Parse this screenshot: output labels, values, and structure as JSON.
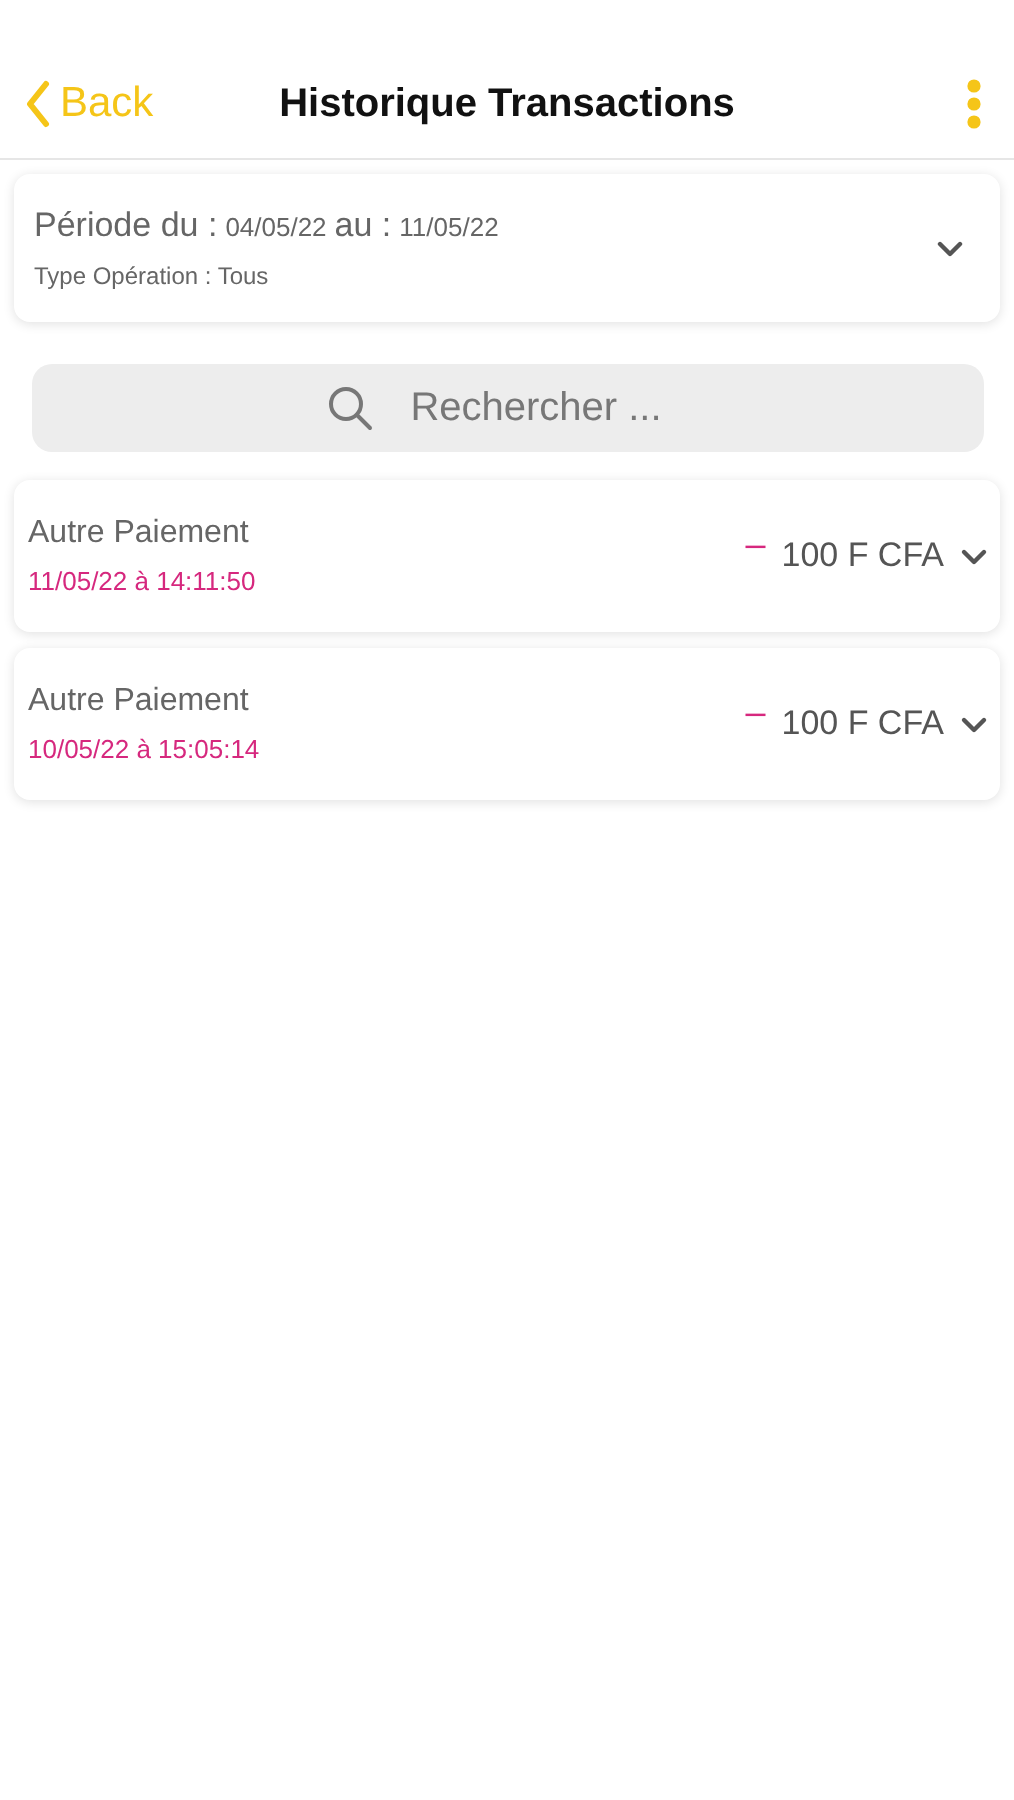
{
  "header": {
    "back": "Back",
    "title": "Historique Transactions"
  },
  "filter": {
    "period": [
      {
        "kind": "label",
        "text": "Période du :"
      },
      {
        "kind": "value",
        "text": "04/05/22"
      },
      {
        "kind": "label",
        "text": "au :"
      },
      {
        "kind": "value",
        "text": "11/05/22"
      }
    ],
    "type": "Type Opération : Tous",
    "expanded": false
  },
  "search": {
    "placeholder": "Rechercher ..."
  },
  "transactions": [
    {
      "label": "Autre Paiement",
      "date": "11/05/22 à 14:11:50",
      "sign": "–",
      "amount": "100 F CFA",
      "expanded": false
    },
    {
      "label": "Autre Paiement",
      "date": "10/05/22 à 15:05:14",
      "sign": "–",
      "amount": "100 F CFA",
      "expanded": false
    }
  ]
}
